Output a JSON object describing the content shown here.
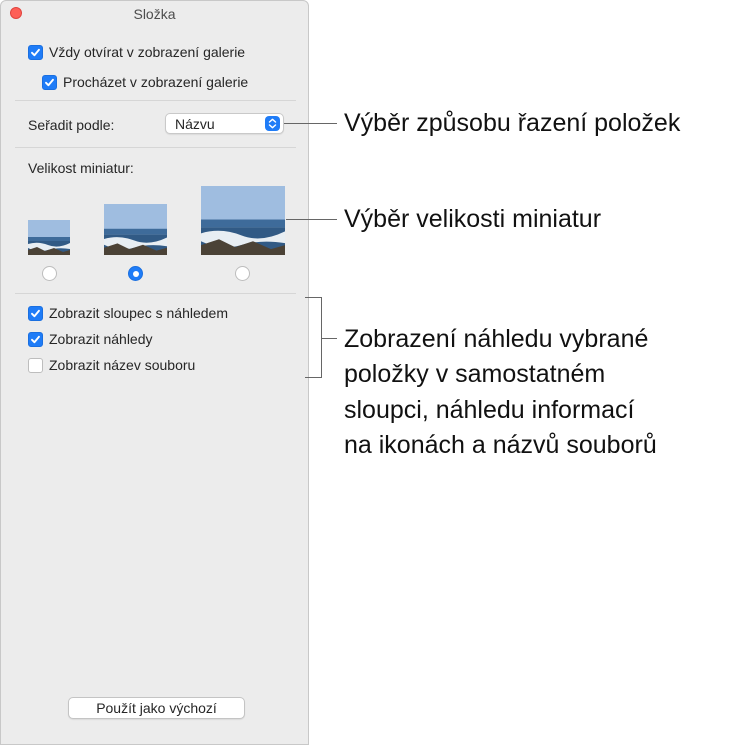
{
  "window": {
    "title": "Složka"
  },
  "options": {
    "always_gallery": {
      "label": "Vždy otvírat v zobrazení galerie",
      "checked": true
    },
    "browse_gallery": {
      "label": "Procházet v zobrazení galerie",
      "checked": true
    }
  },
  "sort": {
    "label": "Seřadit podle:",
    "value": "Názvu"
  },
  "thumb_size": {
    "label": "Velikost miniatur:",
    "options": [
      {
        "size": "small",
        "selected": false
      },
      {
        "size": "medium",
        "selected": true
      },
      {
        "size": "large",
        "selected": false
      }
    ]
  },
  "view": {
    "preview_column": {
      "label": "Zobrazit sloupec s náhledem",
      "checked": true
    },
    "previews": {
      "label": "Zobrazit náhledy",
      "checked": true
    },
    "filename": {
      "label": "Zobrazit název souboru",
      "checked": false
    }
  },
  "default_button": {
    "label": "Použít jako výchozí"
  },
  "callouts": {
    "sort": "Výběr způsobu řazení položek",
    "size": "Výběr velikosti miniatur",
    "preview_l1": "Zobrazení náhledu vybrané",
    "preview_l2": "položky v samostatném",
    "preview_l3": "sloupci, náhledu informací",
    "preview_l4": "na ikonách a názvů souborů"
  },
  "colors": {
    "accent": "#1f7cf7",
    "close": "#fe5f57",
    "panel": "#ececec"
  }
}
